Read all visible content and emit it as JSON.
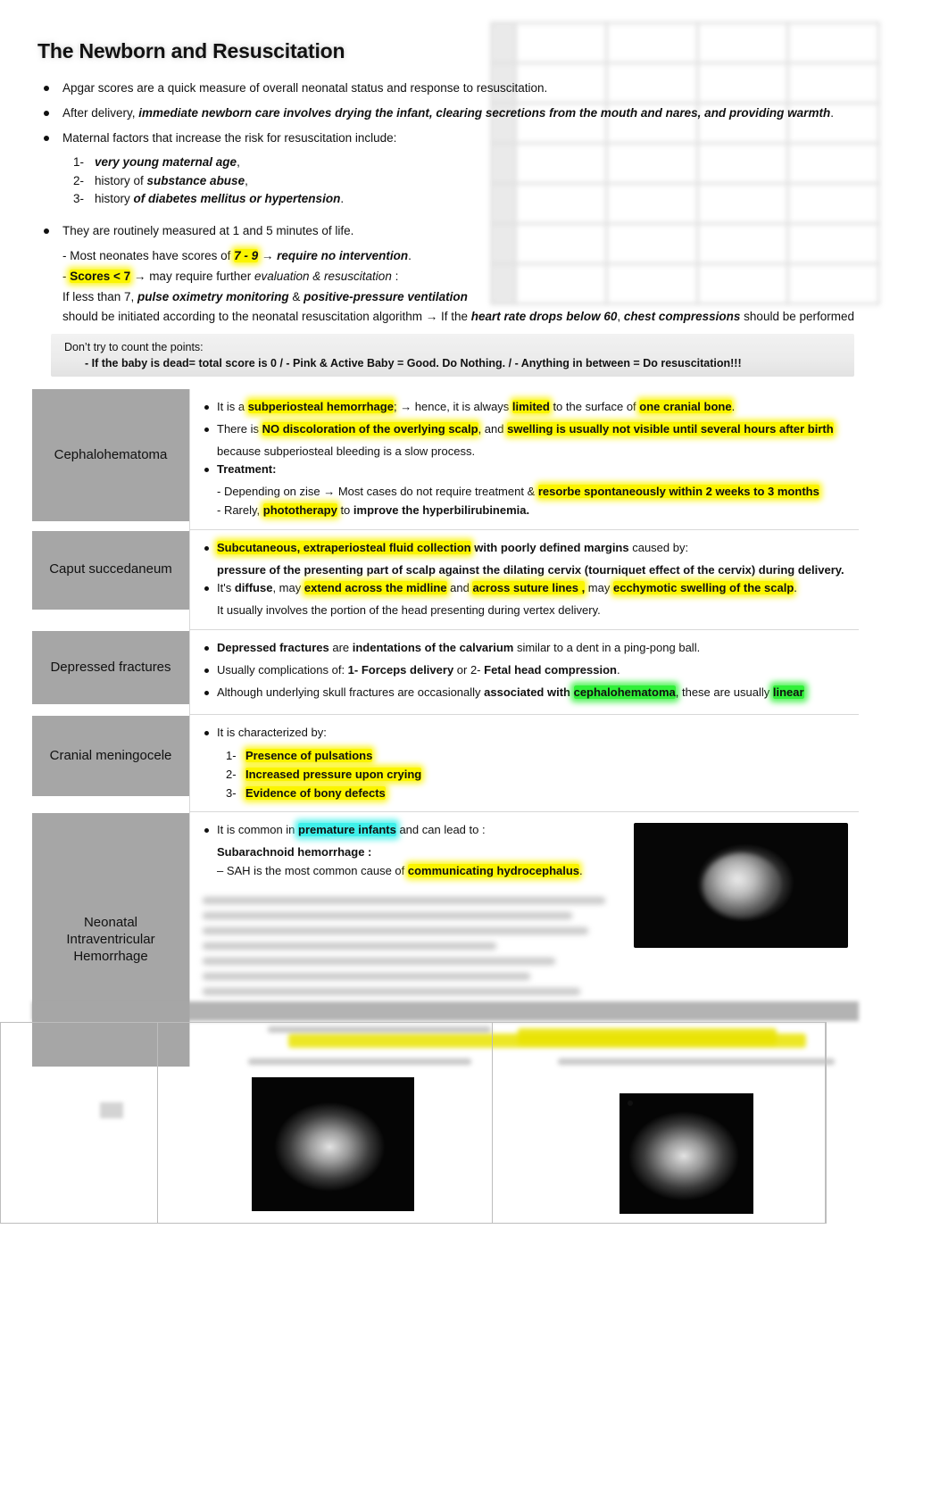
{
  "document": {
    "title": "The Newborn and Resuscitation"
  },
  "intro_bullets": [
    {
      "id": "apgar-definition",
      "parts": [
        {
          "t": "Apgar scores are a quick measure of overall neonatal status and response to resuscitation.",
          "s": "normal"
        }
      ]
    },
    {
      "id": "immediate-newborn-care",
      "parts": [
        {
          "t": "After delivery, ",
          "s": "normal"
        },
        {
          "t": "immediate newborn care involves drying the infant, clearing secretions from the mouth and nares, and providing warmth",
          "s": "bold-italic"
        },
        {
          "t": ".",
          "s": "normal"
        }
      ]
    },
    {
      "id": "maternal-risk-factors",
      "parts": [
        {
          "t": "Maternal factors that increase the risk for resuscitation include:",
          "s": "normal"
        }
      ]
    }
  ],
  "maternal_factors": [
    {
      "num": "1-",
      "parts": [
        {
          "t": "very young maternal age",
          "s": "bold-italic"
        },
        {
          "t": ",",
          "s": "normal"
        }
      ]
    },
    {
      "num": "2-",
      "parts": [
        {
          "t": "history of ",
          "s": "normal"
        },
        {
          "t": "substance abuse",
          "s": "bold-italic"
        },
        {
          "t": ",",
          "s": "normal"
        }
      ]
    },
    {
      "num": "3-",
      "parts": [
        {
          "t": "history ",
          "s": "normal"
        },
        {
          "t": "of diabetes mellitus or hypertension",
          "s": "bold-italic"
        },
        {
          "t": ".",
          "s": "normal"
        }
      ]
    }
  ],
  "scoring": {
    "measured_bullet": "They are routinely measured at 1 and 5 minutes of life.",
    "lines": [
      [
        {
          "t": "- Most neonates have scores of ",
          "s": "normal"
        },
        {
          "t": "7 - 9",
          "s": "bold-italic",
          "hl": "yellow"
        },
        {
          "t": " ",
          "s": "normal"
        },
        {
          "t": "→ require no intervention",
          "s": "bold-italic"
        },
        {
          "t": ".",
          "s": "normal"
        }
      ],
      [
        {
          "t": "- ",
          "s": "normal"
        },
        {
          "t": "Scores < 7",
          "s": "bold",
          "hl": "yellow"
        },
        {
          "t": " →",
          "s": "bold"
        },
        {
          "t": " may require further ",
          "s": "normal"
        },
        {
          "t": "evaluation & resuscitation",
          "s": "italic"
        },
        {
          "t": " :",
          "s": "normal"
        }
      ],
      [
        {
          "t": "If less than 7, ",
          "s": "normal"
        },
        {
          "t": "pulse oximetry monitoring",
          "s": "bold-italic"
        },
        {
          "t": " & ",
          "s": "normal"
        },
        {
          "t": "positive-pressure ventilation",
          "s": "bold-italic"
        }
      ],
      [
        {
          "t": "should be initiated according to the neonatal resuscitation algorithm → If the ",
          "s": "normal"
        },
        {
          "t": "heart rate drops below 60",
          "s": "bold-italic"
        },
        {
          "t": ", ",
          "s": "normal"
        },
        {
          "t": "chest compressions",
          "s": "bold-italic"
        },
        {
          "t": " should be performed",
          "s": "normal"
        }
      ]
    ]
  },
  "count_box": {
    "line1": "Don’t try to count the points:",
    "line2": "- If the baby is dead=  total score is 0  /  - Pink & Active Baby = Good. Do Nothing.   /  - Anything in between = Do resuscitation!!!"
  },
  "table_rows": [
    {
      "category": "Cephalohematoma",
      "content": [
        {
          "type": "bullet",
          "parts": [
            {
              "t": "It is a ",
              "s": "normal"
            },
            {
              "t": "subperiosteal hemorrhage",
              "s": "bold",
              "hl": "yellow"
            },
            {
              "t": "; → hence, it is always ",
              "s": "normal"
            },
            {
              "t": "limited",
              "s": "bold",
              "hl": "yellow"
            },
            {
              "t": " to the surface of ",
              "s": "normal"
            },
            {
              "t": "one cranial bone",
              "s": "bold",
              "hl": "yellow"
            },
            {
              "t": ".",
              "s": "normal"
            }
          ]
        },
        {
          "type": "bullet",
          "parts": [
            {
              "t": "There is ",
              "s": "normal"
            },
            {
              "t": "NO discoloration of the overlying scalp",
              "s": "bold",
              "hl": "yellow"
            },
            {
              "t": ", and ",
              "s": "normal"
            },
            {
              "t": "swelling is usually not visible until several hours after birth",
              "s": "bold",
              "hl": "yellow"
            }
          ]
        },
        {
          "type": "line",
          "parts": [
            {
              "t": "because subperiosteal bleeding is a slow process.",
              "s": "normal"
            }
          ]
        },
        {
          "type": "bullet",
          "parts": [
            {
              "t": "Treatment:",
              "s": "bold"
            }
          ]
        },
        {
          "type": "line",
          "parts": [
            {
              "t": "- Depending on zise → Most cases do not require treatment & ",
              "s": "normal"
            },
            {
              "t": "resorbe spontaneously within 2 weeks to 3 months",
              "s": "bold",
              "hl": "yellow"
            }
          ]
        },
        {
          "type": "line",
          "parts": [
            {
              "t": "- Rarely, ",
              "s": "normal"
            },
            {
              "t": "phototherapy",
              "s": "bold",
              "hl": "yellow"
            },
            {
              "t": " to ",
              "s": "normal"
            },
            {
              "t": "improve the hyperbilirubinemia.",
              "s": "bold"
            }
          ]
        }
      ]
    },
    {
      "category": "Caput succedaneum",
      "content": [
        {
          "type": "bullet",
          "parts": [
            {
              "t": "Subcutaneous, extraperiosteal fluid collection",
              "s": "bold",
              "hl": "yellow"
            },
            {
              "t": " ",
              "s": "normal"
            },
            {
              "t": "with poorly defined margins",
              "s": "bold"
            },
            {
              "t": " caused by:",
              "s": "normal"
            }
          ]
        },
        {
          "type": "line",
          "parts": [
            {
              "t": " pressure of the presenting part of scalp against the dilating cervix (",
              "s": "bold"
            },
            {
              "t": "tourniquet",
              "s": "bold"
            },
            {
              "t": " effect of the cervix) during delivery.",
              "s": "bold"
            }
          ]
        },
        {
          "type": "bullet",
          "parts": [
            {
              "t": "It's ",
              "s": "normal"
            },
            {
              "t": "diffuse",
              "s": "bold"
            },
            {
              "t": ", may ",
              "s": "normal"
            },
            {
              "t": "extend across the midline",
              "s": "bold",
              "hl": "yellow"
            },
            {
              "t": " and ",
              "s": "normal"
            },
            {
              "t": "across suture lines ,",
              "s": "bold",
              "hl": "yellow"
            },
            {
              "t": " may ",
              "s": "normal"
            },
            {
              "t": "ecchymotic swelling of the scalp",
              "s": "bold",
              "hl": "yellow"
            },
            {
              "t": ".",
              "s": "normal"
            }
          ]
        },
        {
          "type": "line",
          "parts": [
            {
              "t": "It usually involves the portion of the head presenting during vertex delivery.",
              "s": "normal"
            }
          ]
        }
      ]
    },
    {
      "category": "Depressed fractures",
      "content": [
        {
          "type": "bullet",
          "parts": [
            {
              "t": "Depressed fractures",
              "s": "bold"
            },
            {
              "t": " are ",
              "s": "normal"
            },
            {
              "t": "indentations of the calvarium",
              "s": "bold"
            },
            {
              "t": " similar to a dent in a ping-pong ball.",
              "s": "normal"
            }
          ]
        },
        {
          "type": "bullet",
          "parts": [
            {
              "t": "Usually complications of: ",
              "s": "normal"
            },
            {
              "t": "1- Forceps delivery",
              "s": "bold"
            },
            {
              "t": "   or 2-  ",
              "s": "normal"
            },
            {
              "t": "Fetal head compression",
              "s": "bold"
            },
            {
              "t": ".",
              "s": "normal"
            }
          ]
        },
        {
          "type": "bullet",
          "parts": [
            {
              "t": "Although underlying skull fractures are occasionally ",
              "s": "normal"
            },
            {
              "t": "associated with ",
              "s": "bold"
            },
            {
              "t": "cephalohematoma",
              "s": "bold",
              "hl": "green"
            },
            {
              "t": ", these are usually ",
              "s": "normal"
            },
            {
              "t": "linear",
              "s": "bold",
              "hl": "green"
            }
          ]
        }
      ]
    },
    {
      "category": "Cranial meningocele",
      "content": [
        {
          "type": "bullet",
          "parts": [
            {
              "t": "It is characterized by:",
              "s": "normal"
            }
          ]
        },
        {
          "type": "numbered",
          "num": "1-",
          "parts": [
            {
              "t": "Presence of pulsations",
              "s": "bold",
              "hl": "yellow"
            }
          ]
        },
        {
          "type": "numbered",
          "num": "2-",
          "parts": [
            {
              "t": "Increased pressure upon crying",
              "s": "bold",
              "hl": "yellow"
            }
          ]
        },
        {
          "type": "numbered",
          "num": "3-",
          "parts": [
            {
              "t": "Evidence of bony defects",
              "s": "bold",
              "hl": "yellow"
            }
          ]
        }
      ]
    },
    {
      "category": "Neonatal Intraventricular Hemorrhage",
      "content": [
        {
          "type": "bullet",
          "parts": [
            {
              "t": "It is common in ",
              "s": "normal"
            },
            {
              "t": "premature infants",
              "s": "bold",
              "hl": "cyan"
            },
            {
              "t": " and can lead to :",
              "s": "normal"
            }
          ]
        },
        {
          "type": "line",
          "parts": [
            {
              "t": "Subarachnoid hemorrhage :",
              "s": "bold"
            }
          ]
        },
        {
          "type": "line",
          "parts": [
            {
              "t": "– SAH is the most common cause of ",
              "s": "normal"
            },
            {
              "t": "communicating hydrocephalus",
              "s": "bold",
              "hl": "yellow"
            },
            {
              "t": ".",
              "s": "normal"
            }
          ]
        }
      ]
    }
  ],
  "images": {
    "ct_scan_ivh": "ct-scan-intraventricular-hemorrhage",
    "mri_left": "mri-brain-sagittal",
    "mri_right": "mri-brain-midline"
  }
}
